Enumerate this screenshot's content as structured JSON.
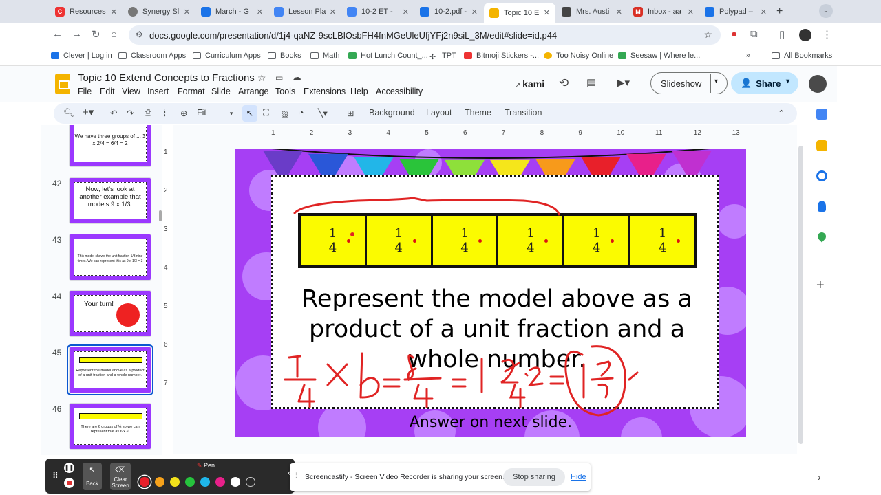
{
  "browser": {
    "tabs": [
      {
        "label": "Resources",
        "icon": "canvas-icon",
        "color": "#e33"
      },
      {
        "label": "Synergy Sl",
        "icon": "globe-icon",
        "color": "#666"
      },
      {
        "label": "March - G",
        "icon": "drive-icon",
        "color": "#1a73e8"
      },
      {
        "label": "Lesson Pla",
        "icon": "docs-icon",
        "color": "#4285f4"
      },
      {
        "label": "10-2 ET -",
        "icon": "docs-icon",
        "color": "#4285f4"
      },
      {
        "label": "10-2.pdf -",
        "icon": "drive-icon",
        "color": "#1a73e8"
      },
      {
        "label": "Topic 10 E",
        "icon": "slides-icon",
        "color": "#f4b400",
        "active": true
      },
      {
        "label": "Mrs. Austi",
        "icon": "classroom-icon",
        "color": "#444"
      },
      {
        "label": "Inbox - aa",
        "icon": "gmail-icon",
        "color": "#d93025"
      },
      {
        "label": "Polypad –",
        "icon": "polypad-icon",
        "color": "#1a73e8"
      }
    ],
    "url": "docs.google.com/presentation/d/1j4-qaNZ-9scLBlOsbFH4fnMGeUleUfjYFj2n9siL_3M/edit#slide=id.p44",
    "bookmarks": [
      "Clever | Log in",
      "Classroom Apps",
      "Curriculum Apps",
      "Books",
      "Math",
      "Hot Lunch Count_...",
      "TPT",
      "Bitmoji Stickers -...",
      "Too Noisy Online",
      "Seesaw | Where le...",
      "All Bookmarks"
    ]
  },
  "app": {
    "title": "Topic 10 Extend Concepts to Fractions",
    "menus": [
      "File",
      "Edit",
      "View",
      "Insert",
      "Format",
      "Slide",
      "Arrange",
      "Tools",
      "Extensions",
      "Help",
      "Accessibility"
    ],
    "kami": "kami",
    "slideshow": "Slideshow",
    "share": "Share"
  },
  "toolbar": {
    "zoom": "Fit",
    "background": "Background",
    "layout": "Layout",
    "theme": "Theme",
    "transition": "Transition"
  },
  "ruler": [
    "1",
    "2",
    "3",
    "4",
    "5",
    "6",
    "7",
    "8",
    "9",
    "10",
    "11",
    "12",
    "13"
  ],
  "vruler": [
    "1",
    "2",
    "3",
    "4",
    "5",
    "6",
    "7"
  ],
  "filmstrip": [
    {
      "num": "",
      "text": "We have three groups of ...  3 x 2/4 = 6/4 = 2"
    },
    {
      "num": "42",
      "text": "Now, let's look at another example that models 9 x 1/3."
    },
    {
      "num": "43",
      "text": "This model shows the unit fraction 1/3 nine times. We can represent this as 9 x 1/3 = 3"
    },
    {
      "num": "44",
      "text": "Your turn!"
    },
    {
      "num": "45",
      "text": "Represent the model above as a product of a unit fraction and a whole number."
    },
    {
      "num": "46",
      "text": "There are 6 groups of ¼ so we can represent that as 6 x ¼"
    }
  ],
  "slide": {
    "model_fraction": {
      "num": "1",
      "den": "4"
    },
    "model_count": 6,
    "prompt": "Represent the model above as a product of a unit fraction and a whole number.",
    "answer_hint": "Answer on next slide."
  },
  "screencastify": {
    "pen_label": "Pen",
    "back": "Back",
    "clear": "Clear Screen",
    "message": "Screencastify - Screen Video Recorder is sharing your screen.",
    "stop": "Stop sharing",
    "hide": "Hide",
    "colors": [
      "#e8202a",
      "#f7a21b",
      "#f3e21b",
      "#26c33d",
      "#1fb6ea",
      "#e8208a",
      "#ffffff",
      "#2a2a2a"
    ]
  }
}
